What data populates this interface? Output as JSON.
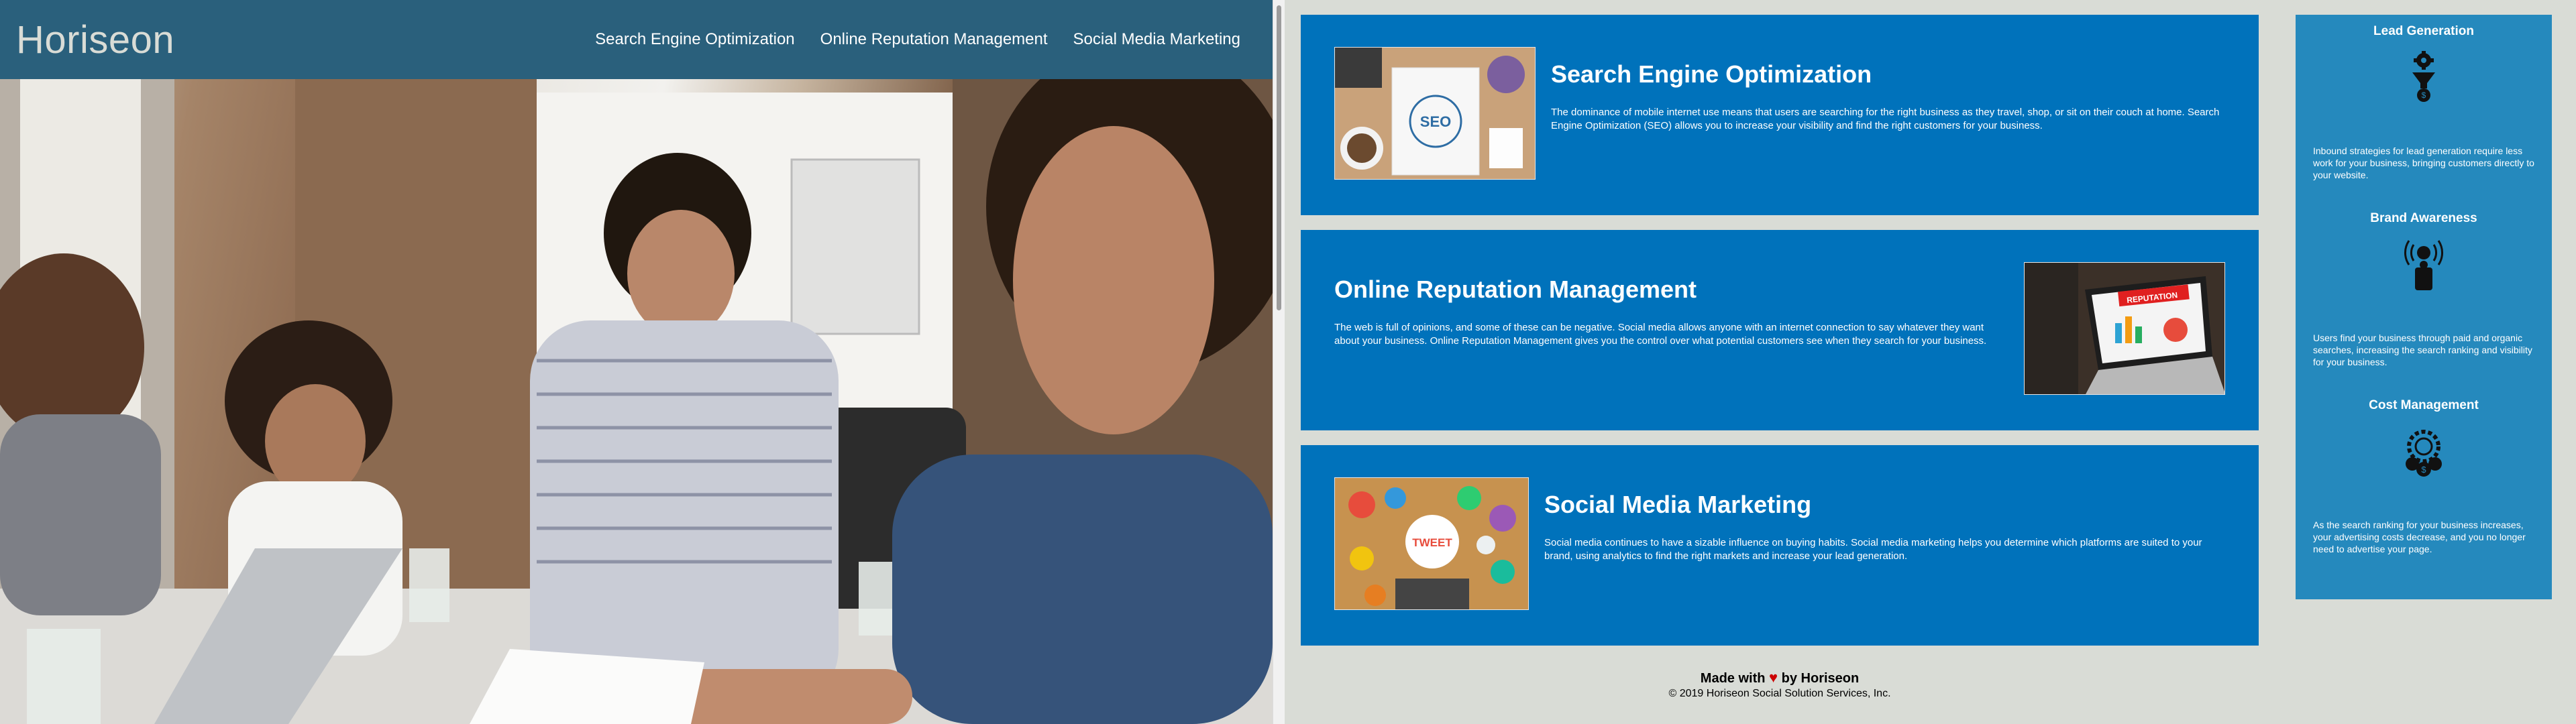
{
  "header": {
    "logo": "Horiseon",
    "nav": [
      {
        "label": "Search Engine Optimization"
      },
      {
        "label": "Online Reputation Management"
      },
      {
        "label": "Social Media Marketing"
      }
    ]
  },
  "cards": [
    {
      "title": "Search Engine Optimization",
      "text": "The dominance of mobile internet use means that users are searching for the right business as they travel, shop, or sit on their couch at home. Search Engine Optimization (SEO) allows you to increase your visibility and find the right customers for your business.",
      "image_label": "SEO"
    },
    {
      "title": "Online Reputation Management",
      "text": "The web is full of opinions, and some of these can be negative. Social media allows anyone with an internet connection to say whatever they want about your business. Online Reputation Management gives you the control over what potential customers see when they search for your business.",
      "image_label": "REPUTATION"
    },
    {
      "title": "Social Media Marketing",
      "text": "Social media continues to have a sizable influence on buying habits. Social media marketing helps you determine which platforms are suited to your brand, using analytics to find the right markets and increase your lead generation.",
      "image_label": "TWEET"
    }
  ],
  "benefits": [
    {
      "title": "Lead Generation",
      "icon": "lead-generation-icon",
      "text": "Inbound strategies for lead generation require less work for your business, bringing customers directly to your website."
    },
    {
      "title": "Brand Awareness",
      "icon": "brand-awareness-icon",
      "text": "Users find your business through paid and organic searches, increasing the search ranking and visibility for your business."
    },
    {
      "title": "Cost Management",
      "icon": "cost-management-icon",
      "text": "As the search ranking for your business increases, your advertising costs decrease, and you no longer need to advertise your page."
    }
  ],
  "footer": {
    "made_with": "Made with",
    "by": "by Horiseon",
    "copyright": "© 2019 Horiseon Social Solution Services, Inc."
  },
  "colors": {
    "header": "#2a607c",
    "card": "#0072bb",
    "benefits": "#2589bd",
    "page": "#d9dcd6"
  }
}
